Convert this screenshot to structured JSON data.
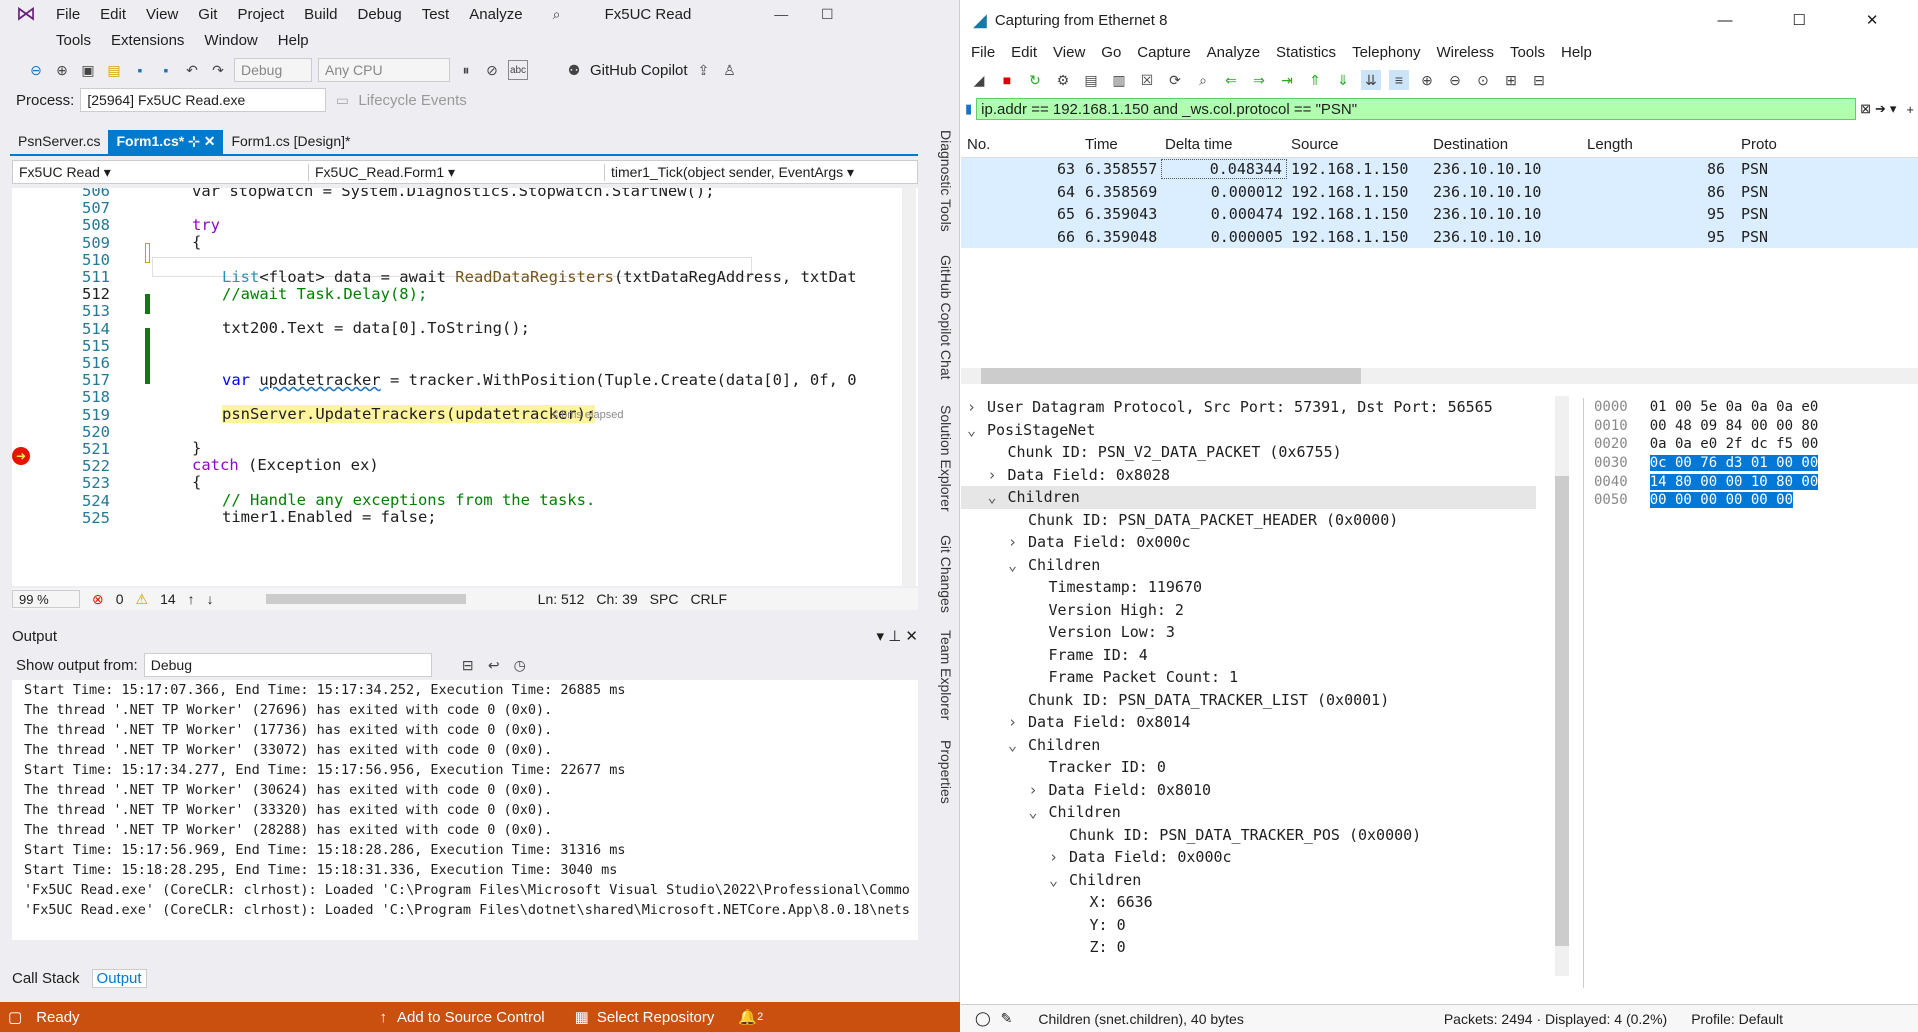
{
  "vs": {
    "menu": [
      "File",
      "Edit",
      "View",
      "Git",
      "Project",
      "Build",
      "Debug",
      "Test",
      "Analyze"
    ],
    "menu2": [
      "Tools",
      "Extensions",
      "Window",
      "Help"
    ],
    "search_icon": "search-icon",
    "project_title": "Fx5UC Read",
    "config": "Debug",
    "platform": "Any CPU",
    "copilot": "GitHub Copilot",
    "process_label": "Process:",
    "process": "[25964] Fx5UC Read.exe",
    "lifecycle": "Lifecycle Events",
    "tabs": [
      {
        "label": "PsnServer.cs"
      },
      {
        "label": "Form1.cs*"
      },
      {
        "label": "Form1.cs [Design]*"
      }
    ],
    "nav1": "Fx5UC Read",
    "nav2": "Fx5UC_Read.Form1",
    "nav3": "timer1_Tick(object sender, EventArgs",
    "lines": [
      "506",
      "507",
      "508",
      "509",
      "510",
      "511",
      "512",
      "513",
      "514",
      "515",
      "516",
      "517",
      "518",
      "519",
      "520",
      "521",
      "522",
      "523",
      "524",
      "525"
    ],
    "code": {
      "l506": "var stopwatch = System.Diagnostics.Stopwatch.StartNew();",
      "l508": "try",
      "l509": "{",
      "l511a": "List",
      "l511b": "<float> data = await ",
      "l511c": "ReadDataRegisters",
      "l511d": "(txtDataRegAddress, txtDat",
      "l512": "//await Task.Delay(8);",
      "l514": "txt200.Text = data[0].ToString();",
      "l517a": "var ",
      "l517b": "updatetracker",
      "l517c": " = tracker.WithPosition(Tuple.Create(data[0], 0f, 0",
      "l519": "psnServer.UpdateTrackers(updatetracker);",
      "l519b": "≤ 6ms elapsed",
      "l521": "}",
      "l522a": "catch ",
      "l522b": "(Exception ex)",
      "l523": "{",
      "l524": "// Handle any exceptions from the tasks.",
      "l525": "timer1.Enabled = false;"
    },
    "editor_status": {
      "zoom": "99 %",
      "errors": "0",
      "warnings": "14",
      "ln": "Ln: 512",
      "ch": "Ch: 39",
      "spc": "SPC",
      "crlf": "CRLF"
    },
    "output": {
      "title": "Output",
      "show_from": "Show output from:",
      "source": "Debug",
      "lines": [
        "Start Time: 15:17:07.366, End Time: 15:17:34.252, Execution Time: 26885 ms",
        "The thread '.NET TP Worker' (27696) has exited with code 0 (0x0).",
        "The thread '.NET TP Worker' (17736) has exited with code 0 (0x0).",
        "The thread '.NET TP Worker' (33072) has exited with code 0 (0x0).",
        "Start Time: 15:17:34.277, End Time: 15:17:56.956, Execution Time: 22677 ms",
        "The thread '.NET TP Worker' (30624) has exited with code 0 (0x0).",
        "The thread '.NET TP Worker' (33320) has exited with code 0 (0x0).",
        "The thread '.NET TP Worker' (28288) has exited with code 0 (0x0).",
        "Start Time: 15:17:56.969, End Time: 15:18:28.286, Execution Time: 31316 ms",
        "Start Time: 15:18:28.295, End Time: 15:18:31.336, Execution Time: 3040 ms",
        "'Fx5UC Read.exe' (CoreCLR: clrhost): Loaded 'C:\\Program Files\\Microsoft Visual Studio\\2022\\Professional\\Commo",
        "'Fx5UC Read.exe' (CoreCLR: clrhost): Loaded 'C:\\Program Files\\dotnet\\shared\\Microsoft.NETCore.App\\8.0.18\\nets"
      ],
      "tab_callstack": "Call Stack",
      "tab_output": "Output"
    },
    "side_tabs": [
      "Diagnostic Tools",
      "GitHub Copilot Chat",
      "Solution Explorer",
      "Git Changes",
      "Team Explorer",
      "Properties"
    ],
    "status": {
      "ready": "Ready",
      "source_control": "Add to Source Control",
      "repo": "Select Repository",
      "notifications": "2",
      "accent": "#ca5010"
    }
  },
  "ws": {
    "title": "Capturing from Ethernet 8",
    "menu": [
      "File",
      "Edit",
      "View",
      "Go",
      "Capture",
      "Analyze",
      "Statistics",
      "Telephony",
      "Wireless",
      "Tools",
      "Help"
    ],
    "filter": "ip.addr ==  192.168.1.150 and _ws.col.protocol == \"PSN\"",
    "cols": [
      "No.",
      "Time",
      "Delta time",
      "Source",
      "Destination",
      "Length",
      "Proto"
    ],
    "packets": [
      {
        "no": "63",
        "time": "6.358557",
        "delta": "0.048344",
        "src": "192.168.1.150",
        "dst": "236.10.10.10",
        "len": "86",
        "proto": "PSN"
      },
      {
        "no": "64",
        "time": "6.358569",
        "delta": "0.000012",
        "src": "192.168.1.150",
        "dst": "236.10.10.10",
        "len": "86",
        "proto": "PSN"
      },
      {
        "no": "65",
        "time": "6.359043",
        "delta": "0.000474",
        "src": "192.168.1.150",
        "dst": "236.10.10.10",
        "len": "95",
        "proto": "PSN"
      },
      {
        "no": "66",
        "time": "6.359048",
        "delta": "0.000005",
        "src": "192.168.1.150",
        "dst": "236.10.10.10",
        "len": "95",
        "proto": "PSN"
      }
    ],
    "details": [
      {
        "arrow": "›",
        "text": "User Datagram Protocol, Src Port: 57391, Dst Port: 56565",
        "indent": 0
      },
      {
        "arrow": "⌄",
        "text": "PosiStageNet",
        "indent": 0
      },
      {
        "arrow": "",
        "text": "Chunk ID: PSN_V2_DATA_PACKET (0x6755)",
        "indent": 1
      },
      {
        "arrow": "›",
        "text": "Data Field: 0x8028",
        "indent": 1
      },
      {
        "arrow": "⌄",
        "text": "Children",
        "indent": 1
      },
      {
        "arrow": "",
        "text": "Chunk ID: PSN_DATA_PACKET_HEADER (0x0000)",
        "indent": 2
      },
      {
        "arrow": "›",
        "text": "Data Field: 0x000c",
        "indent": 2
      },
      {
        "arrow": "⌄",
        "text": "Children",
        "indent": 2
      },
      {
        "arrow": "",
        "text": "Timestamp: 119670",
        "indent": 3
      },
      {
        "arrow": "",
        "text": "Version High: 2",
        "indent": 3
      },
      {
        "arrow": "",
        "text": "Version Low: 3",
        "indent": 3
      },
      {
        "arrow": "",
        "text": "Frame ID: 4",
        "indent": 3
      },
      {
        "arrow": "",
        "text": "Frame Packet Count: 1",
        "indent": 3
      },
      {
        "arrow": "",
        "text": "Chunk ID: PSN_DATA_TRACKER_LIST (0x0001)",
        "indent": 2
      },
      {
        "arrow": "›",
        "text": "Data Field: 0x8014",
        "indent": 2
      },
      {
        "arrow": "⌄",
        "text": "Children",
        "indent": 2
      },
      {
        "arrow": "",
        "text": "Tracker ID: 0",
        "indent": 3
      },
      {
        "arrow": "›",
        "text": "Data Field: 0x8010",
        "indent": 3
      },
      {
        "arrow": "⌄",
        "text": "Children",
        "indent": 3
      },
      {
        "arrow": "",
        "text": "Chunk ID: PSN_DATA_TRACKER_POS (0x0000)",
        "indent": 4
      },
      {
        "arrow": "›",
        "text": "Data Field: 0x000c",
        "indent": 4
      },
      {
        "arrow": "⌄",
        "text": "Children",
        "indent": 4
      },
      {
        "arrow": "",
        "text": "X: 6636",
        "indent": 5
      },
      {
        "arrow": "",
        "text": "Y: 0",
        "indent": 5
      },
      {
        "arrow": "",
        "text": "Z: 0",
        "indent": 5
      }
    ],
    "hex": [
      {
        "off": "0000",
        "bytes": "01 00 5e 0a 0a 0a e0"
      },
      {
        "off": "0010",
        "bytes": "00 48 09 84 00 00 80"
      },
      {
        "off": "0020",
        "bytes": "0a 0a e0 2f dc f5 00"
      },
      {
        "off": "0030",
        "bytes": "0c 00 76 d3 01 00 00"
      },
      {
        "off": "0040",
        "bytes": "14 80 00 00 10 80 00"
      },
      {
        "off": "0050",
        "bytes": "00 00 00 00 00 00"
      }
    ],
    "status": {
      "field": "Children (snet.children), 40 bytes",
      "packets": "Packets: 2494 · Displayed: 4 (0.2%)",
      "profile": "Profile: Default"
    },
    "colors": {
      "filter_bg": "#afffaf",
      "row_bg": "#dbeeff",
      "select": "#0078d7"
    }
  }
}
